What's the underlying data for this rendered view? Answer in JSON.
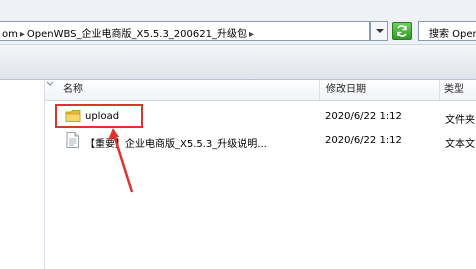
{
  "address_bar": {
    "path_segments": [
      "om",
      "OpenWBS_企业电商版_X5.5.3_200621_升级包"
    ],
    "separator": "▸"
  },
  "search": {
    "label": "搜索 OpenW"
  },
  "columns": {
    "name": "名称",
    "date": "修改日期",
    "type": "类型"
  },
  "files": [
    {
      "name": "upload",
      "date": "2020/6/22 1:12",
      "type": "文件夹",
      "icon": "folder-icon",
      "highlighted": true
    },
    {
      "name": "【重要】企业电商版_X5.5.3_升级说明...",
      "date": "2020/6/22 1:12",
      "type": "文本文",
      "icon": "text-document-icon"
    }
  ],
  "colors": {
    "annotation": "#e0332c",
    "folder": "#f2c94c"
  }
}
